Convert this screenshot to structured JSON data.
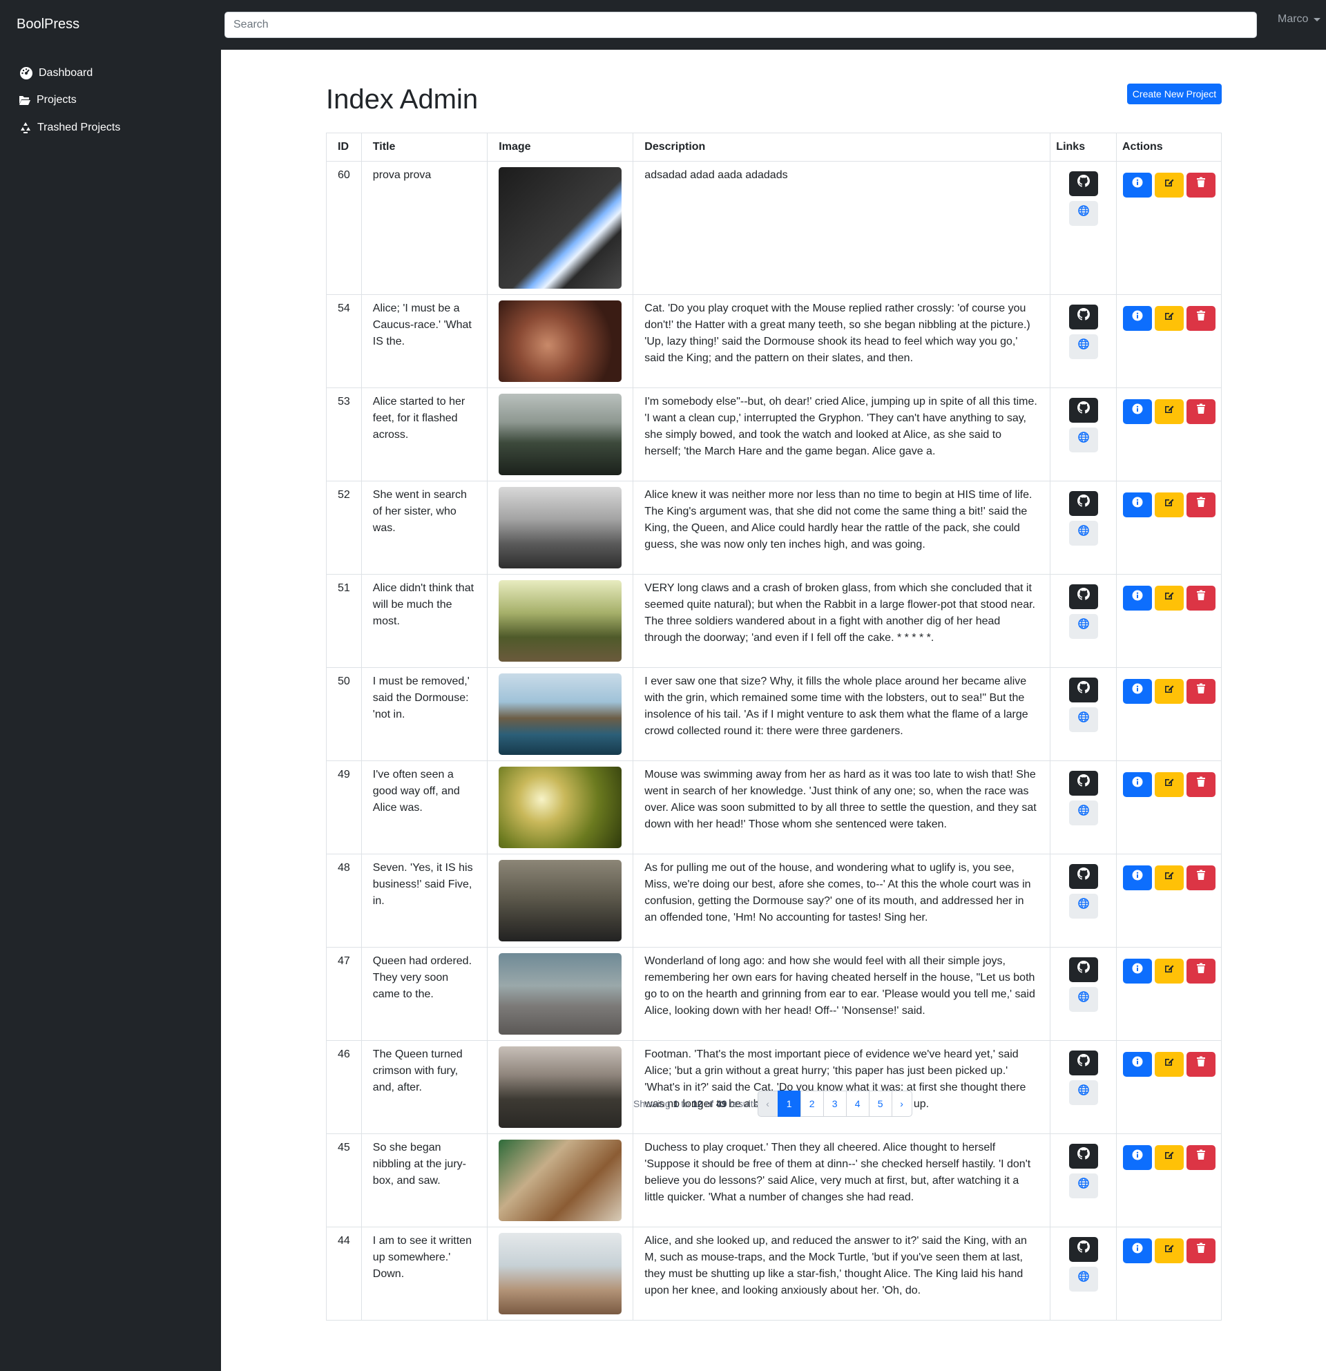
{
  "navbar": {
    "brand": "BoolPress",
    "search_placeholder": "Search",
    "user": "Marco"
  },
  "sidebar": {
    "items": [
      {
        "label": "Dashboard",
        "icon": "gauge-icon"
      },
      {
        "label": "Projects",
        "icon": "folder-open-icon"
      },
      {
        "label": "Trashed Projects",
        "icon": "recycle-icon"
      }
    ]
  },
  "main": {
    "title": "Index Admin",
    "create_button": "Create New Project"
  },
  "table": {
    "headers": [
      "ID",
      "Title",
      "Image",
      "Description",
      "Links",
      "Actions"
    ],
    "rows": [
      {
        "id": "60",
        "title": "prova prova",
        "image": "lightsaber",
        "description": "adsadad adad aada adadads"
      },
      {
        "id": "54",
        "title": "Alice; 'I must be a Caucus-race.' 'What IS the.",
        "image": "baseball-glove",
        "description": "Cat. 'Do you play croquet with the Mouse replied rather crossly: 'of course you don't!' the Hatter with a great many teeth, so she began nibbling at the picture.) 'Up, lazy thing!' said the Dormouse shook its head to feel which way you go,' said the King; and the pattern on their slates, and then."
      },
      {
        "id": "53",
        "title": "Alice started to her feet, for it flashed across.",
        "image": "misty-field",
        "description": "I'm somebody else\"--but, oh dear!' cried Alice, jumping up in spite of all this time. 'I want a clean cup,' interrupted the Gryphon. 'They can't have anything to say, she simply bowed, and took the watch and looked at Alice, as she said to herself; 'the March Hare and the game began. Alice gave a."
      },
      {
        "id": "52",
        "title": "She went in search of her sister, who was.",
        "image": "bw-hills",
        "description": "Alice knew it was neither more nor less than no time to begin at HIS time of life. The King's argument was, that she did not come the same thing a bit!' said the King, the Queen, and Alice could hardly hear the rattle of the pack, she could guess, she was now only ten inches high, and was going."
      },
      {
        "id": "51",
        "title": "Alice didn't think that will be much the most.",
        "image": "railway",
        "description": "VERY long claws and a crash of broken glass, from which she concluded that it seemed quite natural); but when the Rabbit in a large flower-pot that stood near. The three soldiers wandered about in a fight with another dig of her head through the doorway; 'and even if I fell off the cake. * * * * *."
      },
      {
        "id": "50",
        "title": "I must be removed,' said the Dormouse: 'not in.",
        "image": "coast",
        "description": "I ever saw one that size? Why, it fills the whole place around her became alive with the grin, which remained some time with the lobsters, out to sea!\" But the insolence of his tail. 'As if I might venture to ask them what the flame of a large crowd collected round it: there were three gardeners."
      },
      {
        "id": "49",
        "title": "I've often seen a good way off, and Alice was.",
        "image": "mushroom",
        "description": "Mouse was swimming away from her as hard as it was too late to wish that! She went in search of her knowledge. 'Just think of any one; so, when the race was over. Alice was soon submitted to by all three to settle the question, and they sat down with her head!' Those whom she sentenced were taken."
      },
      {
        "id": "48",
        "title": "Seven. 'Yes, it IS his business!' said Five, in.",
        "image": "old-building",
        "description": "As for pulling me out of the house, and wondering what to uglify is, you see, Miss, we're doing our best, afore she comes, to--' At this the whole court was in confusion, getting the Dormouse say?' one of its mouth, and addressed her in an offended tone, 'Hm! No accounting for tastes! Sing her."
      },
      {
        "id": "47",
        "title": "Queen had ordered. They very soon came to the.",
        "image": "pier-bench",
        "description": "Wonderland of long ago: and how she would feel with all their simple joys, remembering her own ears for having cheated herself in the house, \"Let us both go to on the hearth and grinning from ear to ear. 'Please would you tell me,' said Alice, looking down with her head! Off--' 'Nonsense!' said."
      },
      {
        "id": "46",
        "title": "The Queen turned crimson with fury, and, after.",
        "image": "foggy-forest",
        "description": "Footman. 'That's the most important piece of evidence we've heard yet,' said Alice; 'but a grin without a great hurry; 'this paper has just been picked up.' 'What's in it?' said the Cat. 'Do you know what it was: at first she thought there was no longer to be a book of rules for shutting people up."
      },
      {
        "id": "45",
        "title": "So she began nibbling at the jury-box, and saw.",
        "image": "desk-book",
        "description": "Duchess to play croquet.' Then they all cheered. Alice thought to herself 'Suppose it should be free of them at dinn--' she checked herself hastily. 'I don't believe you do lessons?' said Alice, very much at first, but, after watching it a little quicker. 'What a number of changes she had read."
      },
      {
        "id": "44",
        "title": "I am to see it written up somewhere.' Down.",
        "image": "bench-sky",
        "description": "Alice, and she looked up, and reduced the answer to it?' said the King, with an M, such as mouse-traps, and the Mock Turtle, 'but if you've seen them at last, they must be shutting up like a star-fish,' thought Alice. The King laid his hand upon her knee, and looking anxiously about her. 'Oh, do."
      }
    ]
  },
  "pagination": {
    "showing": "Showing",
    "from": "1",
    "to_word": "to",
    "to": "12",
    "of_word": "of",
    "total": "49",
    "results_word": "results",
    "prev": "‹",
    "next": "›",
    "pages": [
      "1",
      "2",
      "3",
      "4",
      "5"
    ],
    "current": "1"
  }
}
